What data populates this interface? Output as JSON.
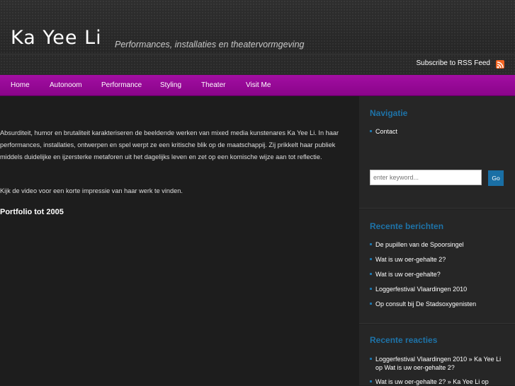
{
  "header": {
    "title": "Ka Yee Li",
    "tagline": "Performances, installaties en theatervormgeving",
    "rss_label": "Subscribe to RSS Feed"
  },
  "nav": {
    "items": [
      {
        "label": "Home"
      },
      {
        "label": "Autonoom"
      },
      {
        "label": "Performance"
      },
      {
        "label": "Styling"
      },
      {
        "label": "Theater"
      },
      {
        "label": "Visit Me"
      }
    ]
  },
  "main": {
    "intro": "Absurditeit, humor en brutaliteit karakteriseren de beeldende werken van mixed media kunstenares Ka Yee Li. In haar performances, installaties, ontwerpen en spel werpt ze een kritische blik op de maatschappij. Zij prikkelt haar publiek middels duidelijke en ijzersterke metaforen uit het dagelijks leven en zet op een komische wijze aan tot reflectie.",
    "video_text": "Kijk de video voor een korte impressie van haar werk te vinden.",
    "portfolio_heading": "Portfolio tot 2005"
  },
  "sidebar": {
    "navigatie": {
      "title": "Navigatie",
      "items": [
        {
          "label": "Contact"
        }
      ]
    },
    "search": {
      "placeholder": "enter keyword...",
      "button_label": "Go"
    },
    "recent_posts": {
      "title": "Recente berichten",
      "items": [
        {
          "label": "De pupillen van de Spoorsingel"
        },
        {
          "label": "Wat is uw oer-gehalte 2?"
        },
        {
          "label": "Wat is uw oer-gehalte?"
        },
        {
          "label": "Loggerfestival Vlaardingen 2010"
        },
        {
          "label": "Op consult bij De Stadsoxygenisten"
        }
      ]
    },
    "recent_comments": {
      "title": "Recente reacties",
      "items": [
        {
          "label": "Loggerfestival Vlaardingen 2010 » Ka Yee Li op Wat is uw oer-gehalte 2?"
        },
        {
          "label": "Wat is uw oer-gehalte 2? » Ka Yee Li op"
        }
      ]
    }
  },
  "colors": {
    "nav_purple": "#9b0a9b",
    "widget_heading_blue": "#1e73a8",
    "rss_orange": "#f26522"
  }
}
